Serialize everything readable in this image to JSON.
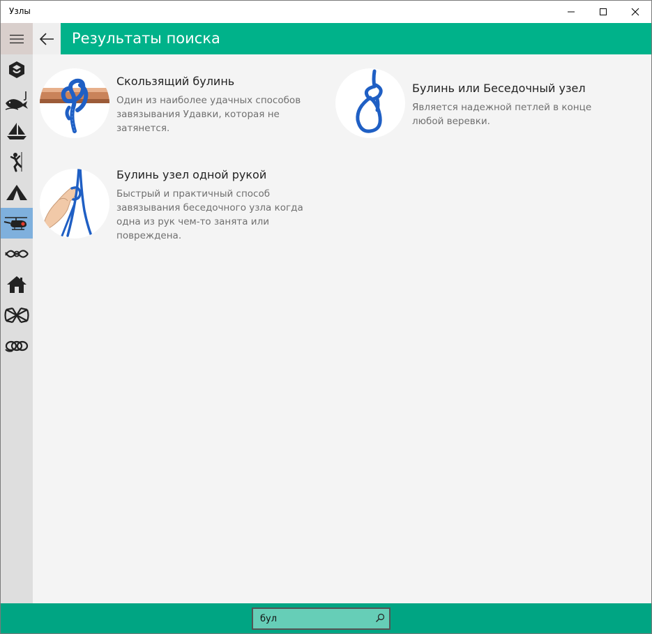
{
  "window": {
    "title": "Узлы"
  },
  "header": {
    "title": "Результаты поиска"
  },
  "sidebar": {
    "items": [
      {
        "icon": "cube-icon",
        "active": false
      },
      {
        "icon": "fishing-icon",
        "active": false
      },
      {
        "icon": "sailboat-icon",
        "active": false
      },
      {
        "icon": "climber-icon",
        "active": false
      },
      {
        "icon": "tent-icon",
        "active": false
      },
      {
        "icon": "helicopter-icon",
        "active": true
      },
      {
        "icon": "decorative-knot-icon",
        "active": false
      },
      {
        "icon": "house-icon",
        "active": false
      },
      {
        "icon": "celtic-knot-icon",
        "active": false
      },
      {
        "icon": "rope-coil-icon",
        "active": false
      }
    ]
  },
  "results": [
    {
      "title": "Скользящий булинь",
      "description": "Один из наиболее удачных способов завязывания Удавки, которая не затянется."
    },
    {
      "title": "Булинь или Беседочный узел",
      "description": "Является надежной петлей в конце любой веревки."
    },
    {
      "title": "Булинь узел одной рукой",
      "description": "Быстрый и практичный способ завязывания беседочного узла когда одна из рук чем-то занята или повреждена."
    }
  ],
  "search": {
    "value": "бул"
  },
  "colors": {
    "accent": "#00b28a",
    "bottom_bar": "#00a583",
    "search_bg": "#66ceb7",
    "active_nav": "#7fb0dd",
    "rope": "#1f5fc4"
  }
}
